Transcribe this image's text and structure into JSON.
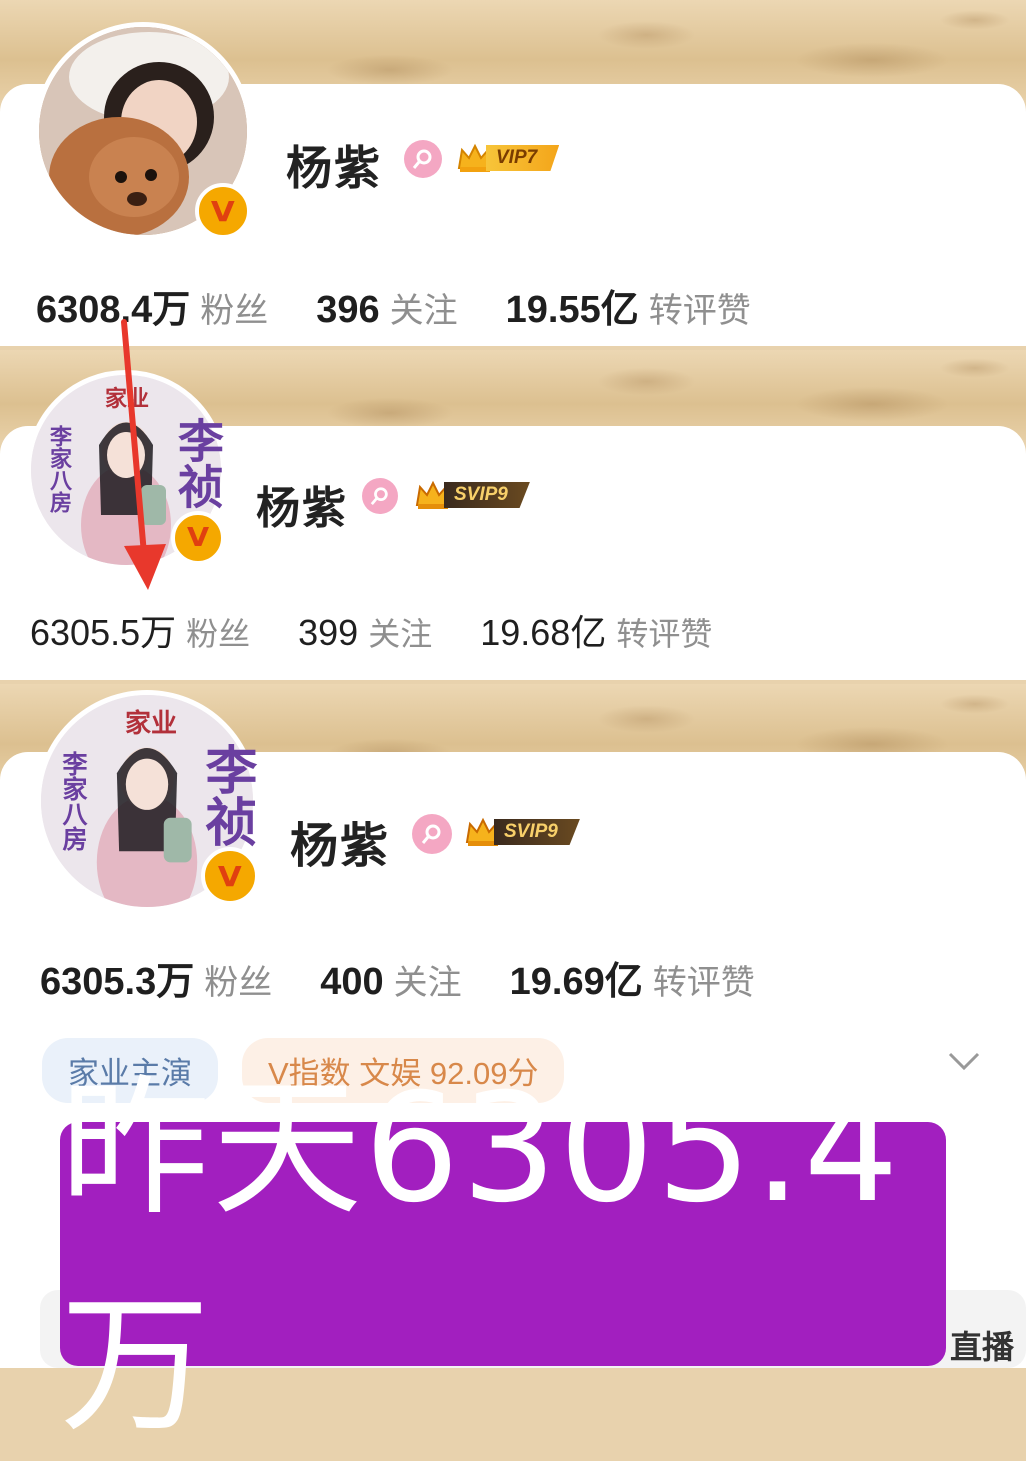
{
  "profiles": [
    {
      "name": "杨紫",
      "vip_label": "VIP7",
      "verified_mark": "V",
      "avatar_description_icon": "avatar-photo",
      "stats": [
        {
          "value": "6308.4万",
          "label": "粉丝"
        },
        {
          "value": "396",
          "label": "关注"
        },
        {
          "value": "19.55亿",
          "label": "转评赞"
        }
      ]
    },
    {
      "name": "杨紫",
      "vip_label": "SVIP9",
      "verified_mark": "V",
      "poster": {
        "top": "家业",
        "left": "李家八房",
        "right": "李祯"
      },
      "stats": [
        {
          "value": "6305.5万",
          "label": "粉丝"
        },
        {
          "value": "399",
          "label": "关注"
        },
        {
          "value": "19.68亿",
          "label": "转评赞"
        }
      ]
    },
    {
      "name": "杨紫",
      "vip_label": "SVIP9",
      "verified_mark": "V",
      "poster": {
        "top": "家业",
        "left": "李家八房",
        "right": "李祯"
      },
      "stats": [
        {
          "value": "6305.3万",
          "label": "粉丝"
        },
        {
          "value": "400",
          "label": "关注"
        },
        {
          "value": "19.69亿",
          "label": "转评赞"
        }
      ],
      "tags": [
        "家业主演",
        "V指数 文娱 92.09分"
      ]
    }
  ],
  "banner_text": "昨天6305.4万",
  "corner_text": "直播",
  "colors": {
    "banner": "#a21fbf",
    "arrow": "#e8382c",
    "vip_gold": "#f4a51a",
    "female_pink": "#f4a7c3"
  }
}
